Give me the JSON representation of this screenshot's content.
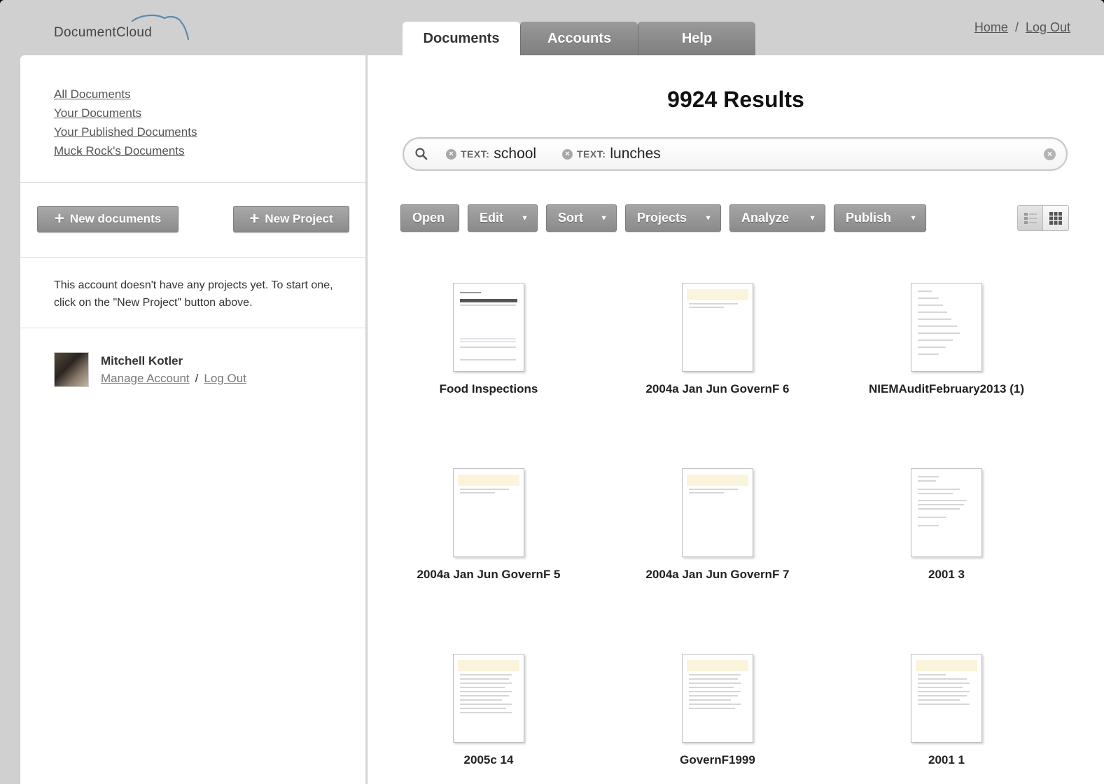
{
  "app": {
    "logo_text": "DocumentCloud"
  },
  "tabs": [
    {
      "label": "Documents",
      "active": true
    },
    {
      "label": "Accounts",
      "active": false
    },
    {
      "label": "Help",
      "active": false
    }
  ],
  "toplinks": {
    "home": "Home",
    "separator": "/",
    "logout": "Log Out"
  },
  "sidebar": {
    "nav": [
      {
        "label": "All Documents"
      },
      {
        "label": "Your Documents"
      },
      {
        "label": "Your Published Documents"
      },
      {
        "label": "Muck Rock's Documents",
        "expandable": true
      }
    ],
    "new_documents_label": "New documents",
    "new_project_label": "New Project",
    "projects_message": "This account doesn't have any projects yet. To start one, click on the \"New Project\" button above.",
    "account": {
      "name": "Mitchell Kotler",
      "manage_label": "Manage Account",
      "separator": "/",
      "logout_label": "Log Out"
    }
  },
  "main": {
    "results_title": "9924 Results",
    "search": {
      "tokens": [
        {
          "key": "TEXT:",
          "value": "school"
        },
        {
          "key": "TEXT:",
          "value": "lunches"
        }
      ]
    },
    "toolbar": [
      {
        "label": "Open",
        "dropdown": false
      },
      {
        "label": "Edit",
        "dropdown": true
      },
      {
        "label": "Sort",
        "dropdown": true
      },
      {
        "label": "Projects",
        "dropdown": true
      },
      {
        "label": "Analyze",
        "dropdown": true
      },
      {
        "label": "Publish",
        "dropdown": true
      }
    ],
    "view_mode": "grid",
    "documents": [
      {
        "title": "Food Inspections",
        "style": "table"
      },
      {
        "title": "2004a Jan Jun GovernF 6",
        "style": "letter"
      },
      {
        "title": "NIEMAuditFebruary2013 (1)",
        "style": "list"
      },
      {
        "title": "2004a Jan Jun GovernF 5",
        "style": "letter"
      },
      {
        "title": "2004a Jan Jun GovernF 7",
        "style": "letter"
      },
      {
        "title": "2001 3",
        "style": "text"
      },
      {
        "title": "2005c 14",
        "style": "dense"
      },
      {
        "title": "GovernF1999",
        "style": "dense"
      },
      {
        "title": "2001 1",
        "style": "text"
      }
    ]
  },
  "colors": {
    "frame_bg": "#d0d0d0",
    "button_gray": "#8b8b8b",
    "panel_bg": "#ffffff"
  }
}
